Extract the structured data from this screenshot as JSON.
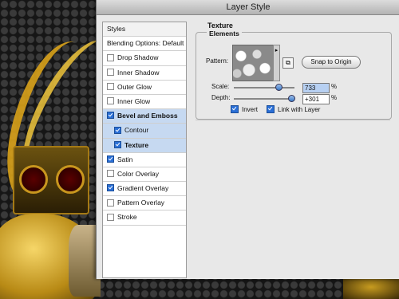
{
  "dialog": {
    "title": "Layer Style"
  },
  "styles_list": [
    {
      "label": "Styles",
      "checkbox": false,
      "checked": false,
      "selected": false,
      "bold": false,
      "sub": false
    },
    {
      "label": "Blending Options: Default",
      "checkbox": false,
      "checked": false,
      "selected": false,
      "bold": false,
      "sub": false
    },
    {
      "label": "Drop Shadow",
      "checkbox": true,
      "checked": false,
      "selected": false,
      "bold": false,
      "sub": false
    },
    {
      "label": "Inner Shadow",
      "checkbox": true,
      "checked": false,
      "selected": false,
      "bold": false,
      "sub": false
    },
    {
      "label": "Outer Glow",
      "checkbox": true,
      "checked": false,
      "selected": false,
      "bold": false,
      "sub": false
    },
    {
      "label": "Inner Glow",
      "checkbox": true,
      "checked": false,
      "selected": false,
      "bold": false,
      "sub": false
    },
    {
      "label": "Bevel and Emboss",
      "checkbox": true,
      "checked": true,
      "selected": true,
      "bold": true,
      "sub": false
    },
    {
      "label": "Contour",
      "checkbox": true,
      "checked": true,
      "selected": true,
      "bold": false,
      "sub": true
    },
    {
      "label": "Texture",
      "checkbox": true,
      "checked": true,
      "selected": true,
      "bold": true,
      "sub": true
    },
    {
      "label": "Satin",
      "checkbox": true,
      "checked": true,
      "selected": false,
      "bold": false,
      "sub": false
    },
    {
      "label": "Color Overlay",
      "checkbox": true,
      "checked": false,
      "selected": false,
      "bold": false,
      "sub": false
    },
    {
      "label": "Gradient Overlay",
      "checkbox": true,
      "checked": true,
      "selected": false,
      "bold": false,
      "sub": false
    },
    {
      "label": "Pattern Overlay",
      "checkbox": true,
      "checked": false,
      "selected": false,
      "bold": false,
      "sub": false
    },
    {
      "label": "Stroke",
      "checkbox": true,
      "checked": false,
      "selected": false,
      "bold": false,
      "sub": false
    }
  ],
  "texture": {
    "section_title": "Texture",
    "group_title": "Elements",
    "pattern_label": "Pattern:",
    "snap_button": "Snap to Origin",
    "scale_label": "Scale:",
    "scale_value": "733",
    "scale_unit": "%",
    "scale_level": 0.733,
    "depth_label": "Depth:",
    "depth_value": "+301",
    "depth_unit": "%",
    "depth_level": 0.95,
    "invert_label": "Invert",
    "invert_checked": true,
    "link_label": "Link with Layer",
    "link_checked": true
  },
  "colors": {
    "accent": "#2a6fd6",
    "selected_row": "#c6d9f1"
  },
  "icons": {
    "pattern_dropdown": "triangle-right-icon",
    "new_preset": "new-preset-icon"
  }
}
